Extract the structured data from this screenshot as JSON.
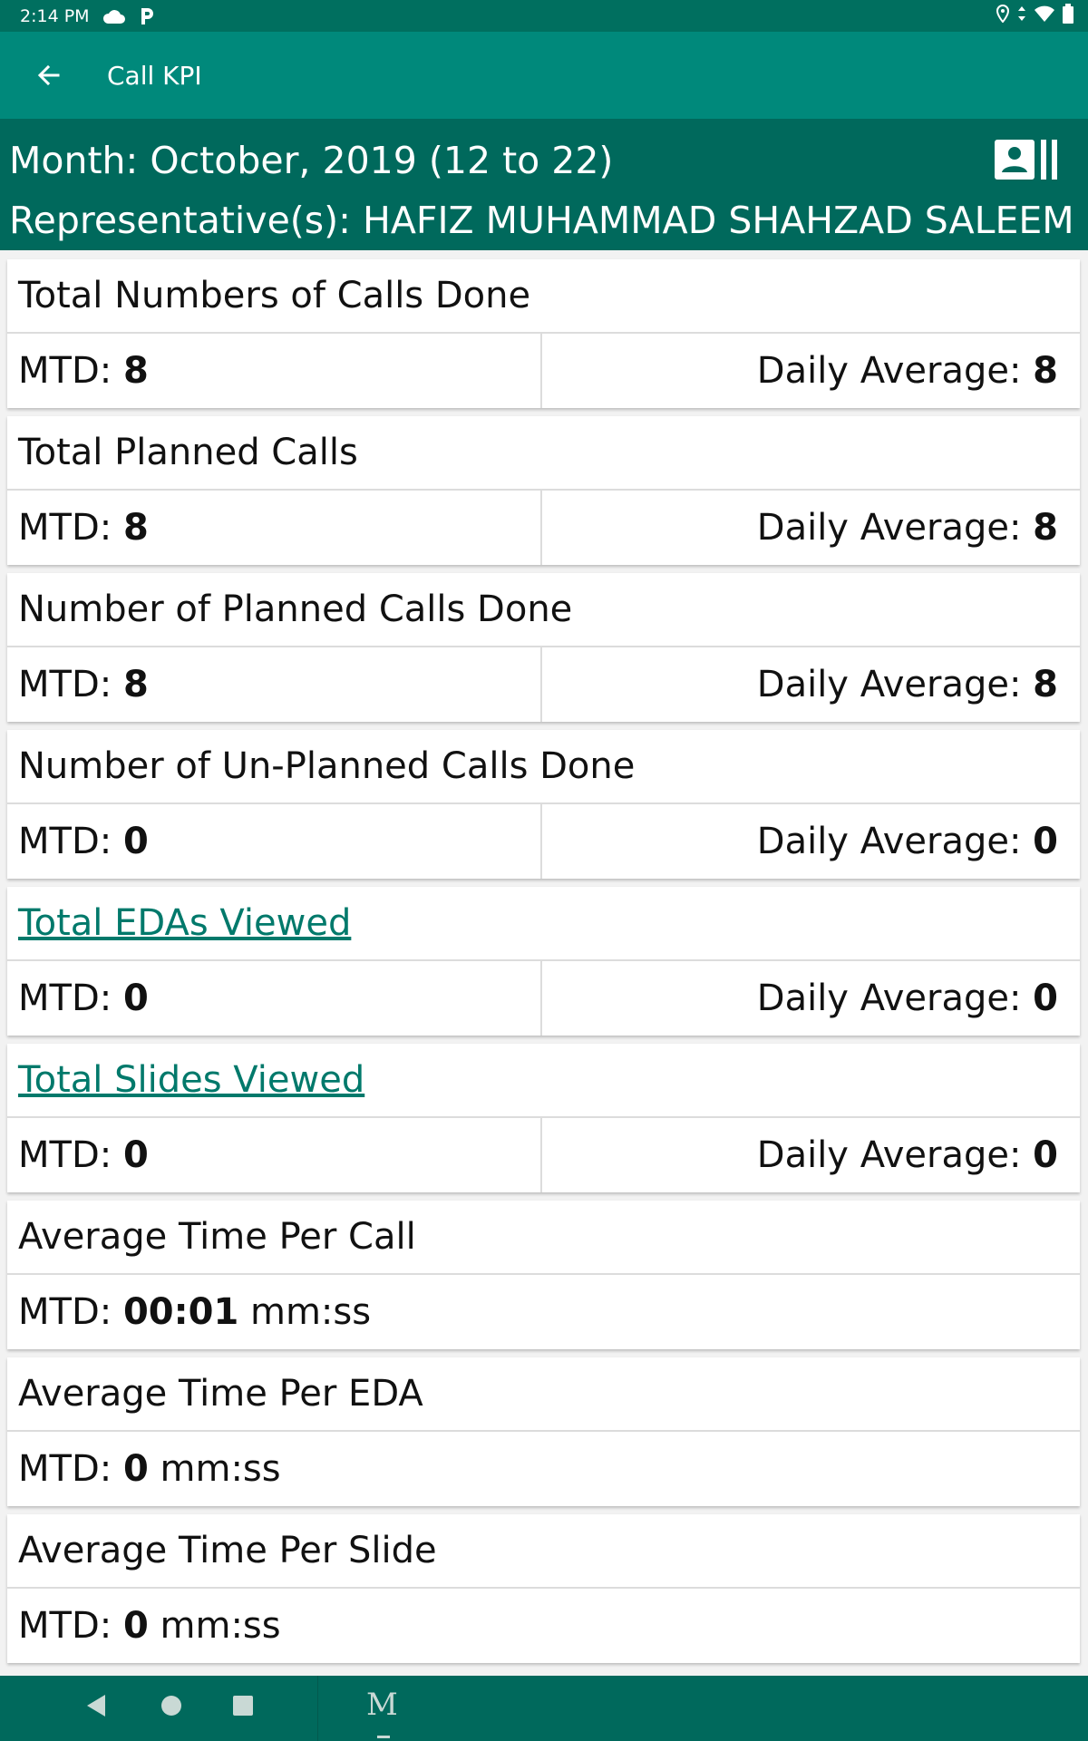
{
  "status_bar": {
    "time": "2:14 PM",
    "icons": [
      "cloud-icon",
      "p-icon"
    ],
    "right_icons": [
      "location-icon",
      "data-arrows-icon",
      "wifi-icon",
      "battery-icon"
    ]
  },
  "app_bar": {
    "title": "Call KPI",
    "back_icon": "arrow-left-icon"
  },
  "header": {
    "month": "Month: October, 2019 (12 to 22)",
    "representative": "Representative(s): HAFIZ MUHAMMAD SHAHZAD SALEEM",
    "contact_icon": "contact-card-icon"
  },
  "kpis": [
    {
      "title": "Total Numbers of Calls Done",
      "mtd_label": "MTD:",
      "mtd": "8",
      "avg_label": "Daily Average:",
      "avg": "8"
    },
    {
      "title": "Total Planned Calls",
      "mtd_label": "MTD:",
      "mtd": "8",
      "avg_label": "Daily Average:",
      "avg": "8"
    },
    {
      "title": "Number of Planned Calls Done",
      "mtd_label": "MTD:",
      "mtd": "8",
      "avg_label": "Daily Average:",
      "avg": "8"
    },
    {
      "title": "Number of Un-Planned Calls Done",
      "mtd_label": "MTD:",
      "mtd": "0",
      "avg_label": "Daily Average:",
      "avg": "0"
    },
    {
      "title": "Total EDAs Viewed",
      "mtd_label": "MTD:",
      "mtd": "0",
      "avg_label": "Daily Average:",
      "avg": "0"
    },
    {
      "title": "Total Slides Viewed",
      "mtd_label": "MTD:",
      "mtd": "0",
      "avg_label": "Daily Average:",
      "avg": "0"
    },
    {
      "title": "Average Time Per Call",
      "mtd_label": "MTD:",
      "mtd": "00:01",
      "unit": "mm:ss"
    },
    {
      "title": "Average Time Per EDA",
      "mtd_label": "MTD:",
      "mtd": "0",
      "unit": "mm:ss"
    },
    {
      "title": "Average Time Per Slide",
      "mtd_label": "MTD:",
      "mtd": "0",
      "unit": "mm:ss"
    }
  ],
  "nav_bar": {
    "logo": "M",
    "icons": [
      "back-triangle-icon",
      "home-circle-icon",
      "recents-square-icon"
    ]
  },
  "colors": {
    "status_bar": "#006f5f",
    "app_bar": "#00897b",
    "header": "#00695c",
    "link": "#00796b",
    "nav_bar": "#00695c"
  }
}
